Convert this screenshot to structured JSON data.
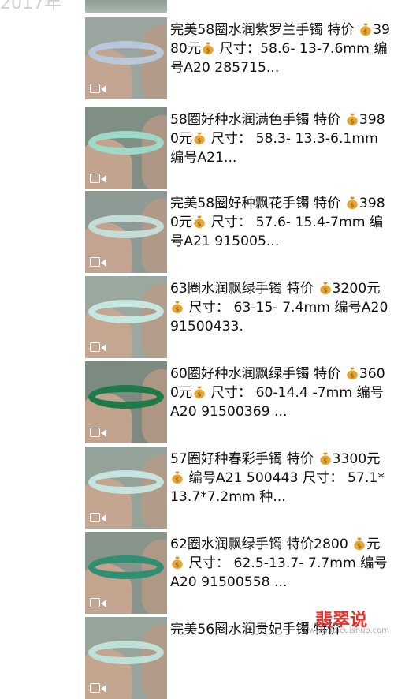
{
  "header": {
    "year": "2017年"
  },
  "items": [
    {
      "lines": [
        "完美58圈水润紫罗兰手镯 特价",
        "3980元",
        " 尺寸：58.6-",
        "13-7.6mm 编号A20 285715..."
      ],
      "colors": {
        "bangle": "#b8c7d9",
        "bg": "#9aa5a0"
      }
    },
    {
      "lines": [
        "58圈好种水润满色手镯 特价",
        "3980元",
        " 尺寸： 58.3-",
        "13.3-6.1mm 编号A21..."
      ],
      "colors": {
        "bangle": "#9ed8c6",
        "bg": "#7f8f84"
      }
    },
    {
      "lines": [
        "完美58圈好种飘花手镯 特价",
        "3980元",
        " 尺寸： 57.6-",
        "15.4-7mm 编号A21 915005..."
      ],
      "colors": {
        "bangle": "#c4ddd6",
        "bg": "#8d9b94"
      }
    },
    {
      "lines": [
        "63圈水润飘绿手镯 特价",
        "3200元",
        " 尺寸： 63-15-",
        "7.4mm 编号A20 91500433."
      ],
      "colors": {
        "bangle": "#c6e6e0",
        "bg": "#9aa89f"
      }
    },
    {
      "lines": [
        "60圈好种水润飘绿手镯 特价",
        "3600元",
        " 尺寸： 60-14.4",
        "-7mm 编号A20 91500369 ..."
      ],
      "colors": {
        "bangle": "#1f7a4a",
        "bg": "#7d8a7f"
      }
    },
    {
      "lines": [
        "57圈好种春彩手镯 特价",
        "3300元",
        " 编号A21 500443",
        "尺寸： 57.1*13.7*7.2mm 种..."
      ],
      "colors": {
        "bangle": "#c7e3dd",
        "bg": "#93a39a"
      }
    },
    {
      "lines": [
        "62圈水润飘绿手镯 特价2800",
        "元",
        " 尺寸： 62.5-13.7-",
        "7.7mm 编号A20 91500558 ..."
      ],
      "colors": {
        "bangle": "#2e8f73",
        "bg": "#87958a"
      }
    },
    {
      "lines": [
        "完美56圈水润贵妃手镯 特价",
        "",
        "",
        ""
      ],
      "colors": {
        "bangle": "#bfe0d6",
        "bg": "#96a49b"
      }
    }
  ],
  "watermark": {
    "logo": "翡翠说",
    "url": "www.feicuishuo.com"
  }
}
